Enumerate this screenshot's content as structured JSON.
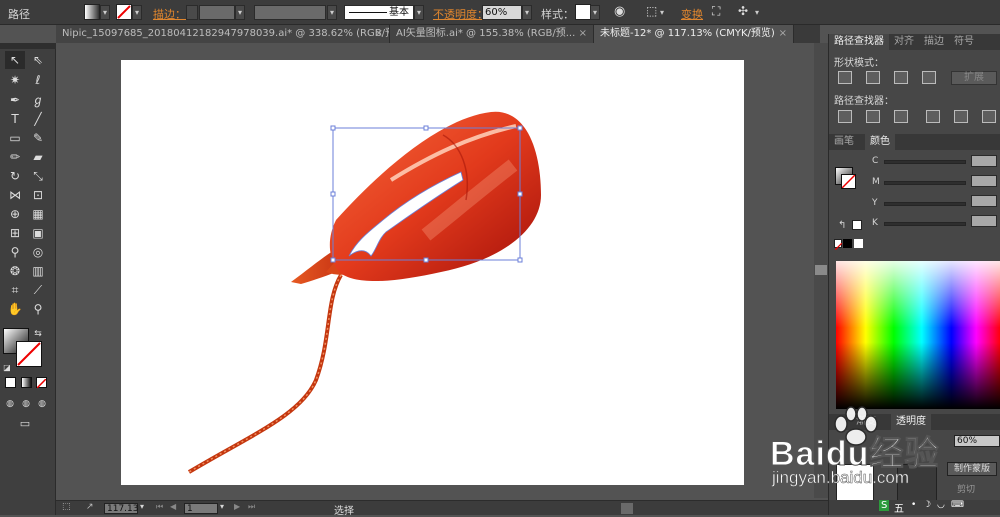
{
  "control_bar": {
    "object_type": "路径",
    "stroke_label": "描边：",
    "stroke_style": "基本",
    "opacity_label": "不透明度：",
    "opacity_value": "60%",
    "style_label": "样式：",
    "transform_label": "变换"
  },
  "tabs": [
    {
      "label": "Nipic_15097685_20180412182947978039.ai* @ 338.62% (RGB/预...",
      "active": false
    },
    {
      "label": "AI矢量图标.ai* @ 155.38% (RGB/预...",
      "active": false
    },
    {
      "label": "未标题-12* @ 117.13% (CMYK/预览)",
      "active": true
    }
  ],
  "status_bar": {
    "zoom": "117.13",
    "page": "1",
    "tool_status": "选择"
  },
  "pathfinder_panel": {
    "tabs": [
      "路径查找器",
      "对齐",
      "描边",
      "符号"
    ],
    "shape_modes_label": "形状模式：",
    "expand_button": "扩展",
    "pathfinders_label": "路径查找器："
  },
  "color_panel": {
    "tabs": [
      "画笔",
      "颜色"
    ],
    "channels": [
      "C",
      "M",
      "Y",
      "K"
    ]
  },
  "transparency_panel": {
    "tabs": [
      "渐变",
      "透明度"
    ],
    "opacity_value": "60%",
    "make_mask_button": "制作蒙版",
    "clip_label": "剪切"
  },
  "watermark": {
    "brand": "Baidu经验",
    "url": "jingyan.baidu.com"
  },
  "colors": {
    "app_bg": "#535353",
    "accent_orange": "#e0862e",
    "art_red": "#d32a12",
    "selection_blue": "#6b7fd8"
  }
}
